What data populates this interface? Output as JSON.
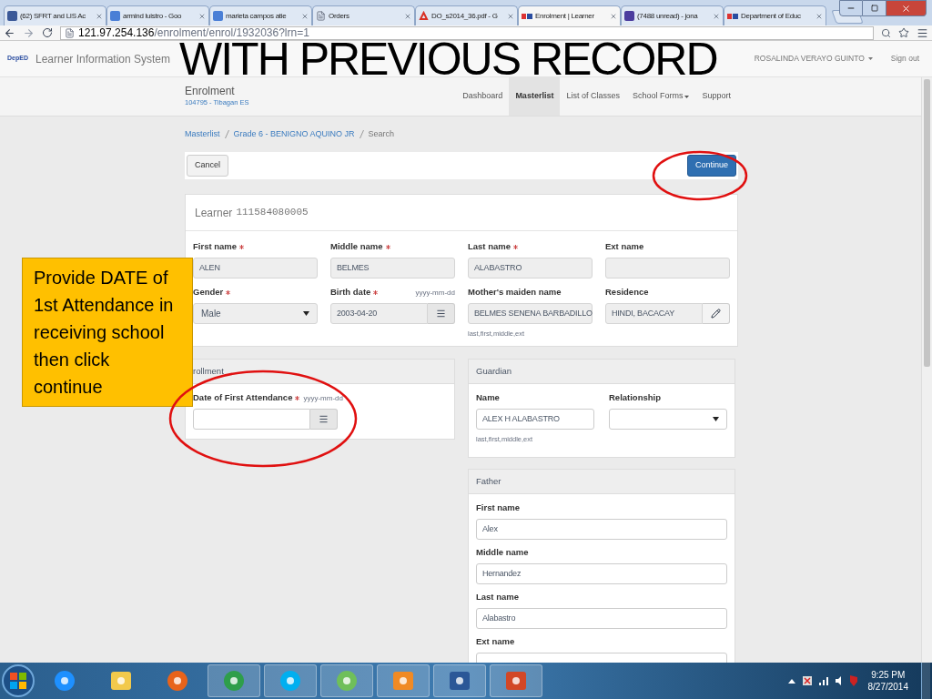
{
  "browser": {
    "tabs": [
      {
        "title": "(62) SFRT and LIS Ac",
        "kind": "facebook",
        "selected": false
      },
      {
        "title": "armind luistro - Goo",
        "kind": "google",
        "selected": false
      },
      {
        "title": "marieta campos atie",
        "kind": "google",
        "selected": false
      },
      {
        "title": "Orders",
        "kind": "page",
        "selected": false
      },
      {
        "title": "DO_s2014_36.pdf - G",
        "kind": "pdf",
        "selected": false
      },
      {
        "title": "Enrolment | Learner",
        "kind": "deped",
        "selected": true
      },
      {
        "title": "(7488 unread) - jona",
        "kind": "mail",
        "selected": false
      },
      {
        "title": "Department of Educ",
        "kind": "deped",
        "selected": false
      }
    ],
    "address": {
      "host": "121.97.254.136",
      "path": "/enrolment/enrol/1932036?lrn=1"
    }
  },
  "annotation": {
    "title": "WITH PREVIOUS RECORD",
    "callout": "Provide DATE of 1st Attendance in receiving school then click continue"
  },
  "navbar": {
    "logo": "DepED",
    "brand": "Learner Information System",
    "user": "ROSALINDA VERAYO GUINTO",
    "sign_out": "Sign out"
  },
  "subnav": {
    "title": "Enrolment",
    "school": "104795 - Tibagan ES",
    "items": [
      {
        "label": "Dashboard",
        "selected": false,
        "dropdown": false
      },
      {
        "label": "Masterlist",
        "selected": true,
        "dropdown": false
      },
      {
        "label": "List of Classes",
        "selected": false,
        "dropdown": false
      },
      {
        "label": "School Forms",
        "selected": false,
        "dropdown": true
      },
      {
        "label": "Support",
        "selected": false,
        "dropdown": false
      }
    ]
  },
  "breadcrumb": [
    {
      "label": "Masterlist",
      "link": true
    },
    {
      "label": "Grade 6 - BENIGNO AQUINO JR",
      "link": true
    },
    {
      "label": "Search",
      "link": false
    }
  ],
  "actions": {
    "cancel": "Cancel",
    "continue": "Continue"
  },
  "learner": {
    "label": "Learner",
    "lrn": "111584080005",
    "fields": [
      {
        "kind": "text",
        "label": "First name",
        "required": true,
        "value": "ALEN"
      },
      {
        "kind": "text",
        "label": "Middle name",
        "required": true,
        "value": "BELMES"
      },
      {
        "kind": "text",
        "label": "Last name",
        "required": true,
        "value": "ALABASTRO"
      },
      {
        "kind": "text",
        "label": "Ext name",
        "required": false
      },
      {
        "kind": "select",
        "label": "Gender",
        "required": true,
        "value": "Male"
      },
      {
        "kind": "date",
        "label": "Birth date",
        "required": true,
        "value": "2003-04-20",
        "format": "yyyy-mm-dd"
      },
      {
        "kind": "text",
        "label": "Mother's maiden name",
        "required": false,
        "value": "BELMES SENENA BARBADILLO",
        "help": "last,first,middle,ext"
      },
      {
        "kind": "picker",
        "label": "Residence",
        "required": false,
        "value": "HINDI, BACACAY"
      }
    ]
  },
  "enrolment": {
    "title": "rollment",
    "fields": [
      {
        "kind": "date",
        "label": "Date of First Attendance",
        "required": true,
        "format": "yyyy-mm-dd"
      }
    ]
  },
  "guardian": {
    "title": "Guardian",
    "fields": [
      {
        "kind": "text",
        "label": "Name",
        "required": false,
        "value": "ALEX H  ALABASTRO",
        "help": "last,first,middle,ext"
      },
      {
        "kind": "select",
        "label": "Relationship",
        "required": false
      }
    ]
  },
  "father": {
    "title": "Father",
    "fields": [
      {
        "kind": "text",
        "label": "First name",
        "required": false,
        "value": "Alex"
      },
      {
        "kind": "text",
        "label": "Middle name",
        "required": false,
        "value": "Hernandez"
      },
      {
        "kind": "text",
        "label": "Last name",
        "required": false,
        "value": "Alabastro"
      },
      {
        "kind": "text",
        "label": "Ext name",
        "required": false
      }
    ]
  },
  "taskbar": {
    "apps": [
      {
        "kind": "ie",
        "running": false
      },
      {
        "kind": "folder",
        "running": false
      },
      {
        "kind": "firefox",
        "running": false
      },
      {
        "kind": "chrome",
        "running": true
      },
      {
        "kind": "skype",
        "running": true
      },
      {
        "kind": "cloud",
        "running": true
      },
      {
        "kind": "media",
        "running": true
      },
      {
        "kind": "word",
        "running": true
      },
      {
        "kind": "powerpoint",
        "running": true
      }
    ],
    "time": "9:25 PM",
    "date": "8/27/2014"
  }
}
